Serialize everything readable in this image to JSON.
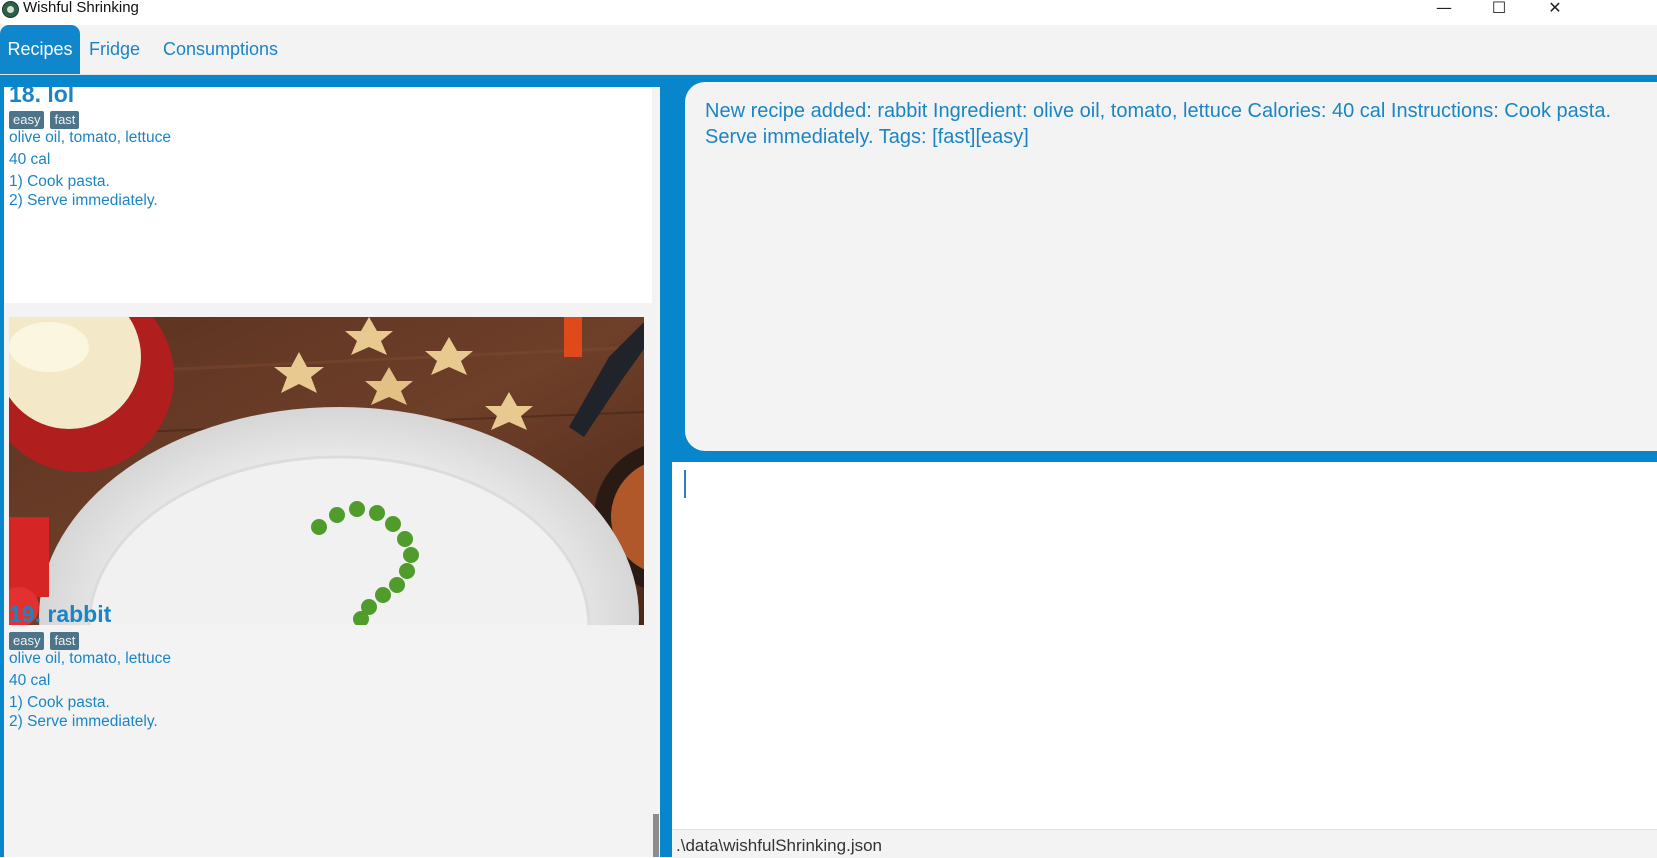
{
  "window": {
    "title": "Wishful Shrinking",
    "minimize": "—",
    "maximize": "☐",
    "close": "✕"
  },
  "tabs": [
    {
      "label": "Recipes",
      "active": true
    },
    {
      "label": "Fridge",
      "active": false
    },
    {
      "label": "Consumptions",
      "active": false
    }
  ],
  "recipes": [
    {
      "index_title": "18.  lol",
      "tags": [
        "easy",
        "fast"
      ],
      "ingredients": " olive oil,  tomato,  lettuce",
      "calories": "40 cal",
      "steps": [
        "1) Cook pasta.",
        "2) Serve immediately."
      ]
    },
    {
      "index_title": "19.  rabbit",
      "image": "food-plate-peas-photo",
      "tags": [
        "easy",
        "fast"
      ],
      "ingredients": " olive oil,  tomato,  lettuce",
      "calories": "40 cal",
      "steps": [
        "1) Cook pasta.",
        "2) Serve immediately."
      ]
    }
  ],
  "result_display": {
    "text": "New recipe added: rabbit Ingredient:  olive oil,  tomato,  lettuce Calories: 40 cal Instructions: Cook pasta.  Serve immediately. Tags: [fast][easy]"
  },
  "command_box": {
    "value": ""
  },
  "status_bar": {
    "path": ".\\data\\wishfulShrinking.json"
  },
  "colors": {
    "accent": "#0786cb",
    "text_blue": "#1a85c6",
    "tag_bg": "#4d7488",
    "panel_bg": "#f3f3f3"
  }
}
